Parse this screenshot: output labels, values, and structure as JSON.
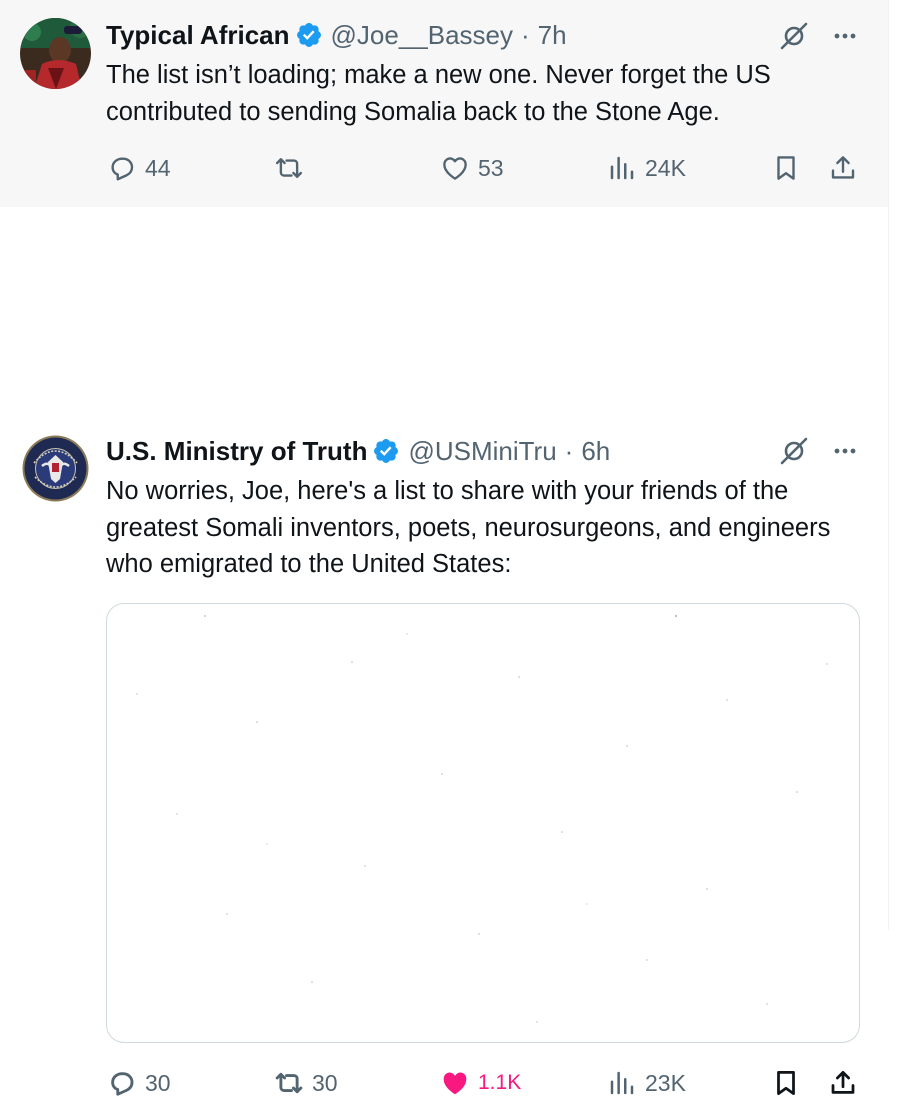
{
  "tweets": [
    {
      "author_name": "Typical African",
      "handle": "@Joe__Bassey",
      "time": "7h",
      "text": "The list isn’t loading; make a new one. Never forget the US contributed to sending Somalia back to the Stone Age.",
      "replies": "44",
      "retweets": "",
      "likes": "53",
      "views": "24K",
      "liked": false
    },
    {
      "author_name": "U.S. Ministry of Truth",
      "handle": "@USMiniTru",
      "time": "6h",
      "text": "No worries, Joe, here's a list to share with your friends of the greatest Somali inventors, poets, neurosurgeons, and engineers who emigrated to the United States:",
      "replies": "30",
      "retweets": "30",
      "likes": "1.1K",
      "views": "23K",
      "liked": true
    }
  ],
  "separator": "·",
  "icons": {
    "verified": "verified-badge-icon",
    "grok": "grok-icon",
    "more": "more-dots-icon",
    "reply": "reply-icon",
    "retweet": "retweet-icon",
    "like": "heart-icon",
    "views": "views-chart-icon",
    "bookmark": "bookmark-icon",
    "share": "share-icon"
  },
  "colors": {
    "verified": "#1d9bf0",
    "like_active": "#f91880",
    "secondary_text": "#536471",
    "highlight_background": "#f7f7f7"
  }
}
